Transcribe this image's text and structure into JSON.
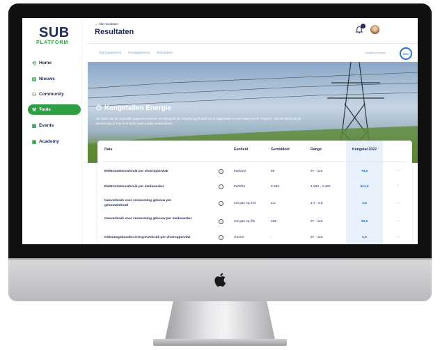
{
  "sidebar": {
    "logo_top": "SUB",
    "logo_bottom": "PLATFORM",
    "items": [
      {
        "label": "Home",
        "icon": "home-icon"
      },
      {
        "label": "Nieuws",
        "icon": "news-icon"
      },
      {
        "label": "Community",
        "icon": "community-icon"
      },
      {
        "label": "Tools",
        "icon": "tools-icon"
      },
      {
        "label": "Events",
        "icon": "events-icon"
      },
      {
        "label": "Academy",
        "icon": "academy-icon"
      }
    ],
    "active_index": 3
  },
  "header": {
    "back_link": "← Alle resultaten",
    "title": "Resultaten",
    "notification_count": "2"
  },
  "tabs": [
    "Stamgegevens",
    "Invulgegevens",
    "Resultaten"
  ],
  "progress": {
    "label": "Voortgang footprint",
    "value_text": "80%",
    "value": 80
  },
  "hero": {
    "title": "Kengetallen Energie",
    "description": "Op basis van de ingevulde gegevens komt er een kengetal uit. Dit getal geeft aan hoe je organisatie er voor staat met de Footprint. Aan de hand van de kleuren kan je zien of er actie moet worden ondernomen."
  },
  "table": {
    "headers": {
      "data": "Data",
      "eenheid": "Eenheid",
      "gemiddeld": "Gemiddeld",
      "range": "Range",
      "kengetal": "Kengetal 2022"
    },
    "rows": [
      {
        "data": "Elektriciteitsverbruik per vloeroppervlak",
        "eenheid": "kWh/m2",
        "gemiddeld": "86",
        "range": "57 - 110",
        "kengetal": "75,0",
        "trend": "—"
      },
      {
        "data": "Elektriciteitsverbruik per medewerker",
        "eenheid": "kWh/fte",
        "gemiddeld": "2.586",
        "range": "1.200 - 4.400",
        "kengetal": "821,9",
        "trend": "↑"
      },
      {
        "data": "Gasverbruik voor verwarming gebouw per gebouwinhoud",
        "eenheid": "m3 gas eq./m3",
        "gemiddeld": "2,2",
        "range": "1,4 - 4,8",
        "kengetal": "3,8",
        "trend": "—"
      },
      {
        "data": "Gasverbruik voor verwarming gebouw per medewerker",
        "eenheid": "m3 gas eq./fte",
        "gemiddeld": "239",
        "range": "57 - 110",
        "kengetal": "99,6",
        "trend": "—"
      },
      {
        "data": "Gebouwgebonden energieverbruik per vloeroppervlak",
        "eenheid": "GJ/m2",
        "gemiddeld": "-",
        "range": "57 - 110",
        "kengetal": "0,5",
        "trend": "—"
      }
    ]
  },
  "colors": {
    "navy": "#1e2a5a",
    "green": "#2f9e44",
    "blue": "#2a73c9",
    "light_blue": "#7ea6c9"
  }
}
